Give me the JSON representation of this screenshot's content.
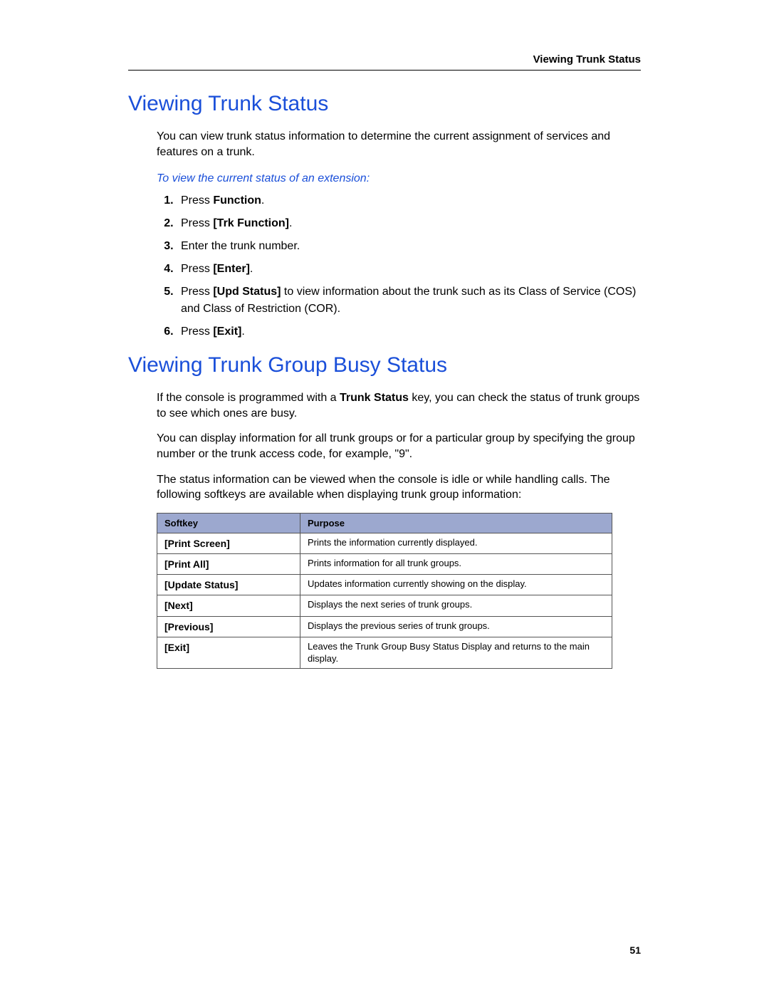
{
  "header": {
    "running_title": "Viewing Trunk Status"
  },
  "section1": {
    "title": "Viewing Trunk Status",
    "intro": "You can view trunk status information to determine the current assignment of services and features on a trunk.",
    "subheading": "To view the current status of an extension:",
    "steps": [
      {
        "pre": "Press ",
        "bold": "Function",
        "post": "."
      },
      {
        "pre": "Press ",
        "bold": "[Trk Function]",
        "post": "."
      },
      {
        "pre": "Enter the trunk number.",
        "bold": "",
        "post": ""
      },
      {
        "pre": "Press ",
        "bold": "[Enter]",
        "post": "."
      },
      {
        "pre": "Press ",
        "bold": "[Upd Status]",
        "post": " to view information about the trunk such as its Class of Service (COS) and Class of Restriction (COR)."
      },
      {
        "pre": "Press ",
        "bold": "[Exit]",
        "post": "."
      }
    ]
  },
  "section2": {
    "title": "Viewing Trunk Group Busy Status",
    "para1_pre": "If the console is programmed with a ",
    "para1_bold": "Trunk Status",
    "para1_post": " key, you can check the status of trunk groups to see which ones are busy.",
    "para2": "You can display information for all trunk groups or for a particular group by specifying the group number or the trunk access code, for example, \"9\".",
    "para3": "The status information can be viewed when the console is idle or while handling calls. The following softkeys are available when displaying trunk group information:",
    "table": {
      "headers": {
        "col1": "Softkey",
        "col2": "Purpose"
      },
      "rows": [
        {
          "key": "[Print Screen]",
          "purpose": "Prints the information currently displayed."
        },
        {
          "key": "[Print All]",
          "purpose": "Prints information for all trunk groups."
        },
        {
          "key": "[Update Status]",
          "purpose": "Updates information currently showing on the display."
        },
        {
          "key": "[Next]",
          "purpose": "Displays the next series of trunk groups."
        },
        {
          "key": "[Previous]",
          "purpose": "Displays the previous series of trunk groups."
        },
        {
          "key": "[Exit]",
          "purpose": "Leaves the Trunk Group Busy Status Display and returns to the main display."
        }
      ]
    }
  },
  "page_number": "51"
}
